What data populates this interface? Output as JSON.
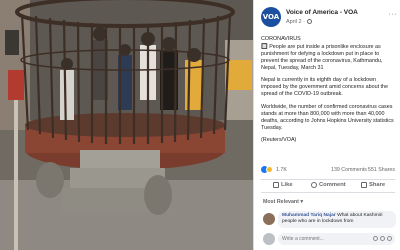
{
  "post": {
    "page_name": "Voice of America - VOA",
    "avatar_text": "VOA",
    "date": "April 2 ·",
    "more_label": "···",
    "body": [
      "CORONAVIRUS",
      "🔲 People are put inside a prisonlike enclosure as punishment for defying a lockdown put in place to prevent the spread of the coronavirus, Kathmandu, Nepal, Tuesday, March 31",
      "Nepal is currently in its eighth day of a lockdown imposed by the government amid concerns about the spread of the COVID-19 outbreak.",
      "Worldwide, the number of confirmed coronavirus cases stands at more than 800,000 with more than 40,000 deaths, according to Johns Hopkins University statistics Tuesday.",
      "(Reuters/VOA)"
    ]
  },
  "reactions": {
    "count": "1.7K",
    "comments": "139 Comments",
    "shares": "551 Shares"
  },
  "actions": {
    "like": "Like",
    "comment": "Comment",
    "share": "Share"
  },
  "comments_section": {
    "sort_label": "Most Relevant ▾",
    "items": [
      {
        "author": "Muhammad Tariq Najar",
        "text": "What about Kashmiri people who are in lockdown from"
      }
    ],
    "write_placeholder": "Write a comment..."
  },
  "colors": {
    "accent": "#1877f2",
    "brand": "#1b4fa0"
  }
}
